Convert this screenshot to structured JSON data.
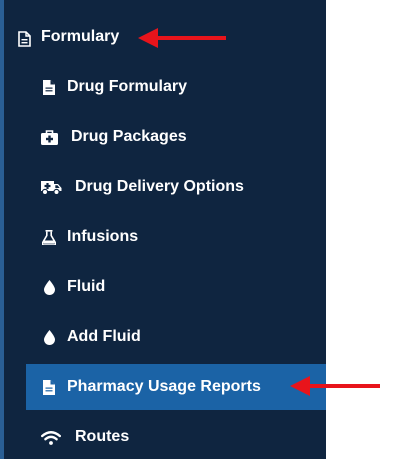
{
  "colors": {
    "sidebar_bg": "#0f2540",
    "active_bg": "#1b63a6",
    "text": "#ffffff",
    "annotation_arrow": "#e8141b"
  },
  "sidebar": {
    "section": {
      "label": "Formulary",
      "icon": "file-alt-icon"
    },
    "items": [
      {
        "label": "Drug Formulary",
        "icon": "file-icon",
        "active": false
      },
      {
        "label": "Drug Packages",
        "icon": "medkit-icon",
        "active": false
      },
      {
        "label": "Drug Delivery Options",
        "icon": "ambulance-icon",
        "active": false
      },
      {
        "label": "Infusions",
        "icon": "flask-icon",
        "active": false
      },
      {
        "label": "Fluid",
        "icon": "tint-icon",
        "active": false
      },
      {
        "label": "Add Fluid",
        "icon": "tint-icon",
        "active": false
      },
      {
        "label": "Pharmacy Usage Reports",
        "icon": "file-icon",
        "active": true
      },
      {
        "label": "Routes",
        "icon": "wifi-icon",
        "active": false
      }
    ]
  },
  "annotations": {
    "arrows": [
      {
        "target": "section-header-formulary",
        "icon": "red-arrow-left-icon"
      },
      {
        "target": "sidebar-item-pharmacy-usage-reports",
        "icon": "red-arrow-left-icon"
      }
    ]
  }
}
